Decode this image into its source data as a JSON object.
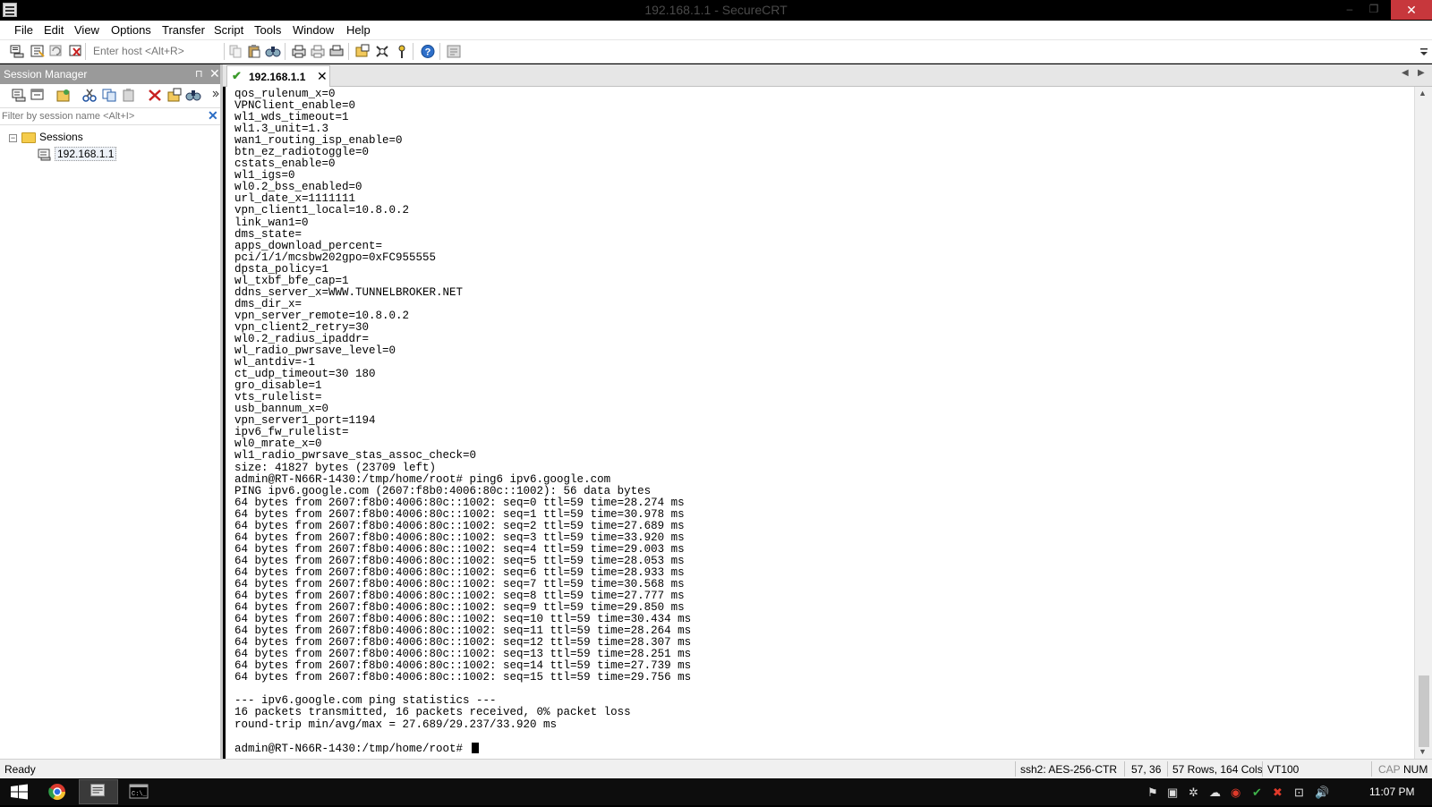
{
  "window": {
    "title": "192.168.1.1 - SecureCRT",
    "minimize": "–",
    "restore": "❐",
    "close": "✕"
  },
  "menu": [
    "File",
    "Edit",
    "View",
    "Options",
    "Transfer",
    "Script",
    "Tools",
    "Window",
    "Help"
  ],
  "toolbar": {
    "host_placeholder": "Enter host <Alt+R>"
  },
  "session_manager": {
    "title": "Session Manager",
    "pin": "⊓",
    "close": "✕",
    "filter_placeholder": "Filter by session name <Alt+I>",
    "filter_clear": "✕",
    "tree": {
      "folder": "Sessions",
      "folder_expander": "−",
      "session": "192.168.1.1"
    }
  },
  "tab": {
    "label": "192.168.1.1",
    "check": "✔",
    "close": "✕",
    "nav_left": "◀",
    "nav_right": "▶"
  },
  "terminal": {
    "lines": [
      "qos_rulenum_x=0",
      "VPNClient_enable=0",
      "wl1_wds_timeout=1",
      "wl1.3_unit=1.3",
      "wan1_routing_isp_enable=0",
      "btn_ez_radiotoggle=0",
      "cstats_enable=0",
      "wl1_igs=0",
      "wl0.2_bss_enabled=0",
      "url_date_x=1111111",
      "vpn_client1_local=10.8.0.2",
      "link_wan1=0",
      "dms_state=",
      "apps_download_percent=",
      "pci/1/1/mcsbw202gpo=0xFC955555",
      "dpsta_policy=1",
      "wl_txbf_bfe_cap=1",
      "ddns_server_x=WWW.TUNNELBROKER.NET",
      "dms_dir_x=",
      "vpn_server_remote=10.8.0.2",
      "vpn_client2_retry=30",
      "wl0.2_radius_ipaddr=",
      "wl_radio_pwrsave_level=0",
      "wl_antdiv=-1",
      "ct_udp_timeout=30 180",
      "gro_disable=1",
      "vts_rulelist=",
      "usb_bannum_x=0",
      "vpn_server1_port=1194",
      "ipv6_fw_rulelist=",
      "wl0_mrate_x=0",
      "wl1_radio_pwrsave_stas_assoc_check=0",
      "size: 41827 bytes (23709 left)",
      "admin@RT-N66R-1430:/tmp/home/root# ping6 ipv6.google.com",
      "PING ipv6.google.com (2607:f8b0:4006:80c::1002): 56 data bytes",
      "64 bytes from 2607:f8b0:4006:80c::1002: seq=0 ttl=59 time=28.274 ms",
      "64 bytes from 2607:f8b0:4006:80c::1002: seq=1 ttl=59 time=30.978 ms",
      "64 bytes from 2607:f8b0:4006:80c::1002: seq=2 ttl=59 time=27.689 ms",
      "64 bytes from 2607:f8b0:4006:80c::1002: seq=3 ttl=59 time=33.920 ms",
      "64 bytes from 2607:f8b0:4006:80c::1002: seq=4 ttl=59 time=29.003 ms",
      "64 bytes from 2607:f8b0:4006:80c::1002: seq=5 ttl=59 time=28.053 ms",
      "64 bytes from 2607:f8b0:4006:80c::1002: seq=6 ttl=59 time=28.933 ms",
      "64 bytes from 2607:f8b0:4006:80c::1002: seq=7 ttl=59 time=30.568 ms",
      "64 bytes from 2607:f8b0:4006:80c::1002: seq=8 ttl=59 time=27.777 ms",
      "64 bytes from 2607:f8b0:4006:80c::1002: seq=9 ttl=59 time=29.850 ms",
      "64 bytes from 2607:f8b0:4006:80c::1002: seq=10 ttl=59 time=30.434 ms",
      "64 bytes from 2607:f8b0:4006:80c::1002: seq=11 ttl=59 time=28.264 ms",
      "64 bytes from 2607:f8b0:4006:80c::1002: seq=12 ttl=59 time=28.307 ms",
      "64 bytes from 2607:f8b0:4006:80c::1002: seq=13 ttl=59 time=28.251 ms",
      "64 bytes from 2607:f8b0:4006:80c::1002: seq=14 ttl=59 time=27.739 ms",
      "64 bytes from 2607:f8b0:4006:80c::1002: seq=15 ttl=59 time=29.756 ms",
      "",
      "--- ipv6.google.com ping statistics ---",
      "16 packets transmitted, 16 packets received, 0% packet loss",
      "round-trip min/avg/max = 27.689/29.237/33.920 ms",
      ""
    ],
    "prompt": "admin@RT-N66R-1430:/tmp/home/root# "
  },
  "scrollbar": {
    "up": "▲",
    "down": "▼"
  },
  "status": {
    "ready": "Ready",
    "encryption": "ssh2: AES-256-CTR",
    "cursor_pos": "57, 36",
    "size": "57 Rows, 164 Cols",
    "terminal_type": "VT100",
    "cap": "CAP",
    "num": "NUM"
  },
  "taskbar": {
    "clock": "11:07 PM",
    "tray_icons": [
      "flag-icon",
      "monitor-icon",
      "network-share-icon",
      "cloud-icon",
      "record-icon",
      "shield-icon",
      "security-alert-icon",
      "network-icon",
      "volume-icon"
    ],
    "tray_glyphs": [
      "⚑",
      "▣",
      "✲",
      "☁",
      "◉",
      "✔",
      "✖",
      "⊡",
      "🔊"
    ]
  },
  "colors": {
    "titlebar_bg": "#000000",
    "close_button": "#c7373c",
    "session_header": "#9a9a9a",
    "tab_check": "#3a9a2a",
    "terminal_bg": "#ffffff",
    "terminal_fg": "#000000",
    "taskbar_bg": "#0d0d0d"
  }
}
